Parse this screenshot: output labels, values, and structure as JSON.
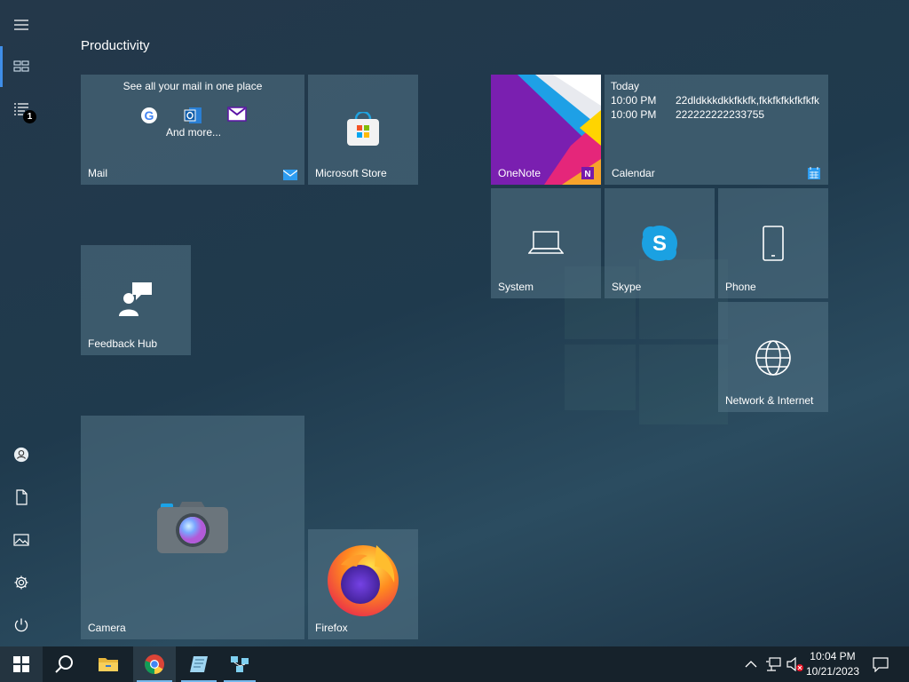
{
  "start_menu": {
    "group_title": "Productivity",
    "rail": {
      "notification_count": "1",
      "items": [
        "hamburger-menu-icon",
        "all-apps-icon",
        "recent-list-icon",
        "user-icon",
        "documents-icon",
        "pictures-icon",
        "settings-icon",
        "power-icon"
      ]
    },
    "tiles": {
      "mail": {
        "label": "Mail",
        "headline": "See all your mail in one place",
        "more": "And more..."
      },
      "store": {
        "label": "Microsoft Store"
      },
      "onenote": {
        "label": "OneNote"
      },
      "calendar": {
        "label": "Calendar",
        "today": "Today",
        "events": [
          {
            "time": "10:00 PM",
            "title": "22dldkkkdkkfkkfk,fkkfkfkkfkfkfk"
          },
          {
            "time": "10:00 PM",
            "title": "222222222233755"
          }
        ]
      },
      "system": {
        "label": "System"
      },
      "skype": {
        "label": "Skype",
        "letter": "S"
      },
      "phone": {
        "label": "Phone"
      },
      "network": {
        "label": "Network & Internet"
      },
      "feedback": {
        "label": "Feedback Hub"
      },
      "camera": {
        "label": "Camera"
      },
      "firefox": {
        "label": "Firefox"
      }
    }
  },
  "taskbar": {
    "apps": [
      "start-icon",
      "search-icon",
      "file-explorer-icon",
      "chrome-icon",
      "notepad-icon",
      "network-app-icon"
    ],
    "clock": {
      "time": "10:04 PM",
      "date": "10/21/2023"
    }
  }
}
